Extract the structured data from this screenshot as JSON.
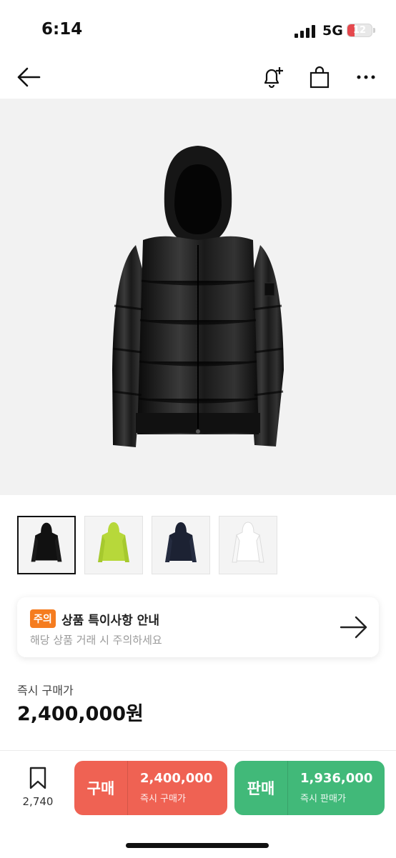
{
  "status_bar": {
    "time": "6:14",
    "network": "5G",
    "battery": "12"
  },
  "header": {
    "back_icon": "arrow-left-icon",
    "alert_icon": "bell-plus-icon",
    "bag_icon": "shopping-bag-icon",
    "more_icon": "more-horizontal-icon"
  },
  "product": {
    "image": "black-puffer-jacket",
    "thumbnails": [
      {
        "color": "#111111",
        "selected": true
      },
      {
        "color": "#b7d83a",
        "selected": false
      },
      {
        "color": "#1c2233",
        "selected": false
      },
      {
        "color": "#f4f4f4",
        "selected": false
      }
    ]
  },
  "notice": {
    "badge": "주의",
    "title": "상품 특이사항 안내",
    "subtitle": "해당 상품 거래 시 주의하세요"
  },
  "price": {
    "label": "즉시 구매가",
    "value": "2,400,000원"
  },
  "bottom_bar": {
    "wish_count": "2,740",
    "buy": {
      "label": "구매",
      "amount": "2,400,000",
      "desc": "즉시 구매가",
      "color": "#ef6253"
    },
    "sell": {
      "label": "판매",
      "amount": "1,936,000",
      "desc": "즉시 판매가",
      "color": "#41b979"
    }
  }
}
